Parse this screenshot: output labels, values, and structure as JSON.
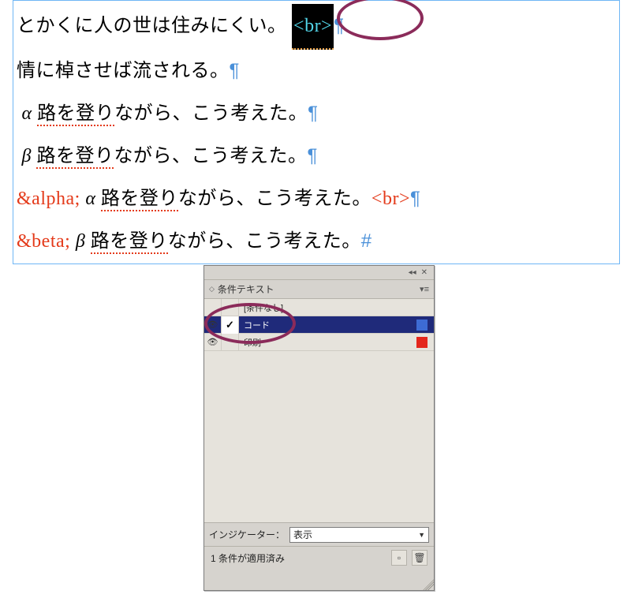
{
  "textFrame": {
    "lines": [
      {
        "text": "とかくに人の世は住みにくい。",
        "highlightBr": "<br>",
        "pilcrow": "¶"
      },
      {
        "text": "情に棹させば流される。",
        "pilcrow": "¶"
      },
      {
        "greek": "α",
        "squiggle": "路を登り",
        "rest": "ながら、こう考えた。",
        "pilcrow": "¶"
      },
      {
        "greek": "β",
        "squiggle": "路を登り",
        "rest": "ながら、こう考えた。",
        "pilcrow": "¶"
      },
      {
        "entity": "&alpha;",
        "greek": "α",
        "squiggle": "路を登り",
        "rest": "ながら、こう考えた。",
        "redBr": "<br>",
        "pilcrow": "¶"
      },
      {
        "entity": "&beta;",
        "greek": "β",
        "squiggle": "路を登り",
        "rest": "ながら、こう考えた。",
        "hash": "#"
      }
    ]
  },
  "panel": {
    "tabTitle": "条件テキスト",
    "conditions": [
      {
        "label": "[条件なし]",
        "swatch": "",
        "selected": false,
        "checked": false,
        "eye": false
      },
      {
        "label": "コード",
        "swatch": "blue",
        "selected": true,
        "checked": true,
        "eye": true
      },
      {
        "label": "印刷",
        "swatch": "red",
        "selected": false,
        "checked": false,
        "eye": true
      }
    ],
    "indicatorLabel": "インジケーター：",
    "indicatorValue": "表示",
    "statusText": "1 条件が適用済み"
  }
}
